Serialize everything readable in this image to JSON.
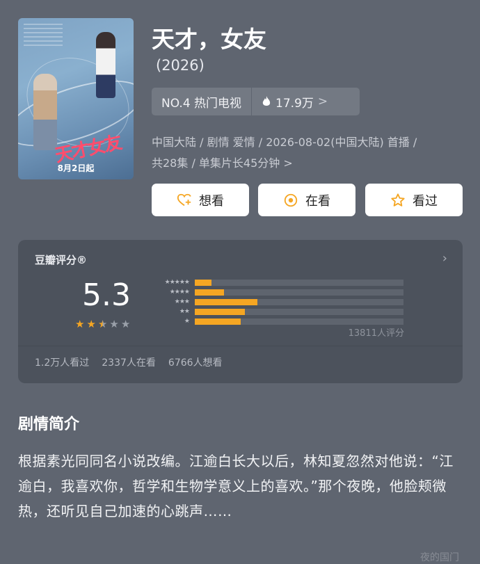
{
  "poster": {
    "title_art": "天才女友",
    "date_text": "8月2日起"
  },
  "title": "天才，女友",
  "year": "(2026)",
  "rank": {
    "label": "NO.4 热门电视",
    "heat": "17.9万",
    "chevron": ">"
  },
  "meta": {
    "line1": "中国大陆 / 剧情 爱情 / 2026-08-02(中国大陆) 首播 /",
    "line2": "共28集 / 单集片长45分钟 >"
  },
  "actions": {
    "want": "想看",
    "watching": "在看",
    "watched": "看过"
  },
  "rating": {
    "header": "豆瓣评分®",
    "score": "5.3",
    "stars_value": 2.5,
    "distribution": [
      {
        "stars": "★★★★★",
        "pct": 8
      },
      {
        "stars": "★★★★",
        "pct": 14
      },
      {
        "stars": "★★★",
        "pct": 30
      },
      {
        "stars": "★★",
        "pct": 24
      },
      {
        "stars": "★",
        "pct": 22
      }
    ],
    "count": "13811人评分",
    "watched": "1.2万人看过",
    "watching": "2337人在看",
    "want": "6766人想看"
  },
  "synopsis": {
    "title": "剧情简介",
    "text": "根据素光同同名小说改编。江逾白长大以后，林知夏忽然对他说：“江逾白，我喜欢你，哲学和生物学意义上的喜欢。”那个夜晚，他脸颊微热，还听见自己加速的心跳声……"
  },
  "watermark": "夜的国门",
  "colors": {
    "background": "#5f6570",
    "card": "#4c525c",
    "star": "#f5a623"
  }
}
